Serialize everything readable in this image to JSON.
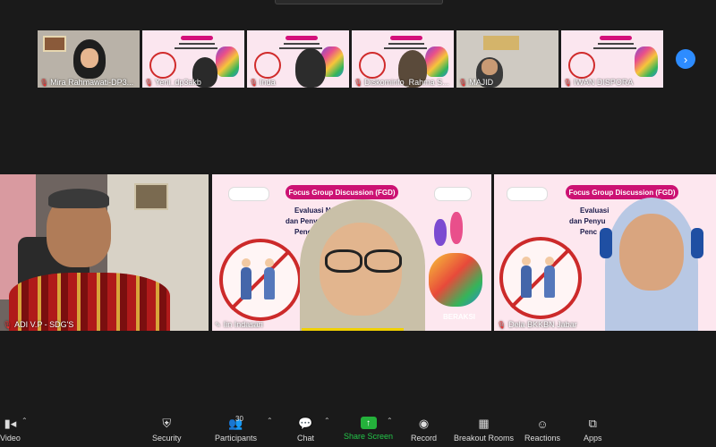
{
  "thumbnails": [
    {
      "name": "Mira Rahmawati-DP3..."
    },
    {
      "name": "Yeni_dp3akb"
    },
    {
      "name": "Inda"
    },
    {
      "name": "Diskominfo_Rahma S..."
    },
    {
      "name": "MAJID"
    },
    {
      "name": "IWAN DISPORA"
    }
  ],
  "tiles": [
    {
      "name": "ADI V.P - SDG'S"
    },
    {
      "name": "Iin Indasari"
    },
    {
      "name": "Dela BKKBN Jabar"
    }
  ],
  "slide": {
    "fgd_label": "Focus Group Discussion (FGD)",
    "line1": "Evaluasi Nota K...",
    "line2": "dan Penyusunan",
    "line3": "Pencegahan",
    "line1_b": "Evaluasi",
    "line2_b": "dan Penyu",
    "line3_b": "Penc",
    "tail": "BERAKSI"
  },
  "toolbar": {
    "video": "Video",
    "security": "Security",
    "participants": "Participants",
    "participants_count": "30",
    "chat": "Chat",
    "share": "Share Screen",
    "record": "Record",
    "breakout": "Breakout Rooms",
    "reactions": "Reactions",
    "apps": "Apps"
  },
  "colors": {
    "background": "#1a1a1a",
    "share_green": "#24b13b",
    "accent_blue": "#2d8cff",
    "slide_pink": "#cc1273"
  }
}
